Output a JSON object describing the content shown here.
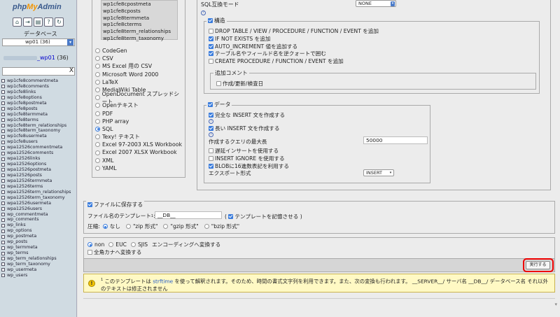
{
  "sidebar": {
    "logo": {
      "php": "php",
      "my": "My",
      "admin": "Admin"
    },
    "icons": [
      "home-icon",
      "exit-icon",
      "query-icon",
      "docs-icon",
      "reload-icon"
    ],
    "database_label": "データベース",
    "db_select_value": "wp01 (36)",
    "current_db": {
      "name": "_wp01",
      "count": "(36)"
    },
    "filter_clear": "X",
    "tables": [
      "wp1cfe8commentmeta",
      "wp1cfe8comments",
      "wp1cfe8links",
      "wp1cfe8options",
      "wp1cfe8postmeta",
      "wp1cfe8posts",
      "wp1cfe8termmeta",
      "wp1cfe8terms",
      "wp1cfe8term_relationships",
      "wp1cfe8term_taxonomy",
      "wp1cfe8usermeta",
      "wp1cfe8users",
      "wpa12526commentmeta",
      "wpa12526comments",
      "wpa12526links",
      "wpa12526options",
      "wpa12526postmeta",
      "wpa12526posts",
      "wpa12526termmeta",
      "wpa12526terms",
      "wpa12526term_relationships",
      "wpa12526term_taxonomy",
      "wpa12526usermeta",
      "wpa12526users",
      "wp_commentmeta",
      "wp_comments",
      "wp_links",
      "wp_options",
      "wp_postmeta",
      "wp_posts",
      "wp_termmeta",
      "wp_terms",
      "wp_term_relationships",
      "wp_term_taxonomy",
      "wp_usermeta",
      "wp_users"
    ]
  },
  "formats": {
    "selected_tables": [
      "wp1cfe8cpostmeta",
      "wp1cfe8cposts",
      "wp1cfe8termmeta",
      "wp1cfe8cterms",
      "wp1cfe8term_relationships",
      "wp1cfe8term_taxonomy"
    ],
    "list": [
      "CodeGen",
      "CSV",
      "MS Excel 用の CSV",
      "Microsoft Word 2000",
      "LaTeX",
      "MediaWiki Table",
      "OpenDocument スプレッドシート",
      "Openテキスト",
      "PDF",
      "PHP array",
      "SQL",
      "Texy! テキスト",
      "Excel 97-2003 XLS Workbook",
      "Excel 2007 XLSX Workbook",
      "XML",
      "YAML"
    ],
    "selected_index": 10
  },
  "options": {
    "sql_mode_label": "SQL互換モード",
    "sql_mode_value": "NONE",
    "structure": {
      "legend": "構造",
      "items": [
        {
          "label": "DROP TABLE / VIEW / PROCEDURE / FUNCTION / EVENT を追加",
          "checked": false
        },
        {
          "label": "IF NOT EXISTS を追加",
          "checked": true
        },
        {
          "label": "AUTO_INCREMENT 値を追加する",
          "checked": true
        },
        {
          "label": "テーブル名やフィールド名を逆クォートで囲む",
          "checked": true
        },
        {
          "label": "CREATE PROCEDURE / FUNCTION / EVENT を追加",
          "checked": false
        }
      ],
      "comment_legend": "追加コメント",
      "comment_item": "作成/更新/検査日"
    },
    "data": {
      "legend": "データ",
      "complete_insert": "完全な INSERT 文を作成する",
      "extended_insert": "長い INSERT 文を作成する",
      "max_query_label": "作成するクエリの最大長",
      "max_query_value": "50000",
      "delayed": "遅延インサートを使用する",
      "ignore": "INSERT IGNORE を使用する",
      "hex": "BLOBに16進数表記を利用する",
      "export_type_label": "エクスポート形式",
      "export_type_value": "INSERT"
    }
  },
  "save": {
    "legend": "ファイルに保存する",
    "template_label": "ファイル名のテンプレート",
    "template_sup": "1",
    "template_value": "__DB__",
    "remember_label": "テンプレートを記憶させる",
    "compression_label": "圧縮:",
    "compression_options": [
      "なし",
      "\"zip 形式\"",
      "\"gzip 形式\"",
      "\"bzip 形式\""
    ],
    "compression_selected": 0
  },
  "charset": {
    "options": [
      "non",
      "EUC",
      "SJIS"
    ],
    "selected": 0,
    "suffix": "エンコーディングへ変換する",
    "kana": "全角カナへ変換する"
  },
  "go_button": "実行する",
  "notice": {
    "sup": "1",
    "before": " このテンプレートは ",
    "link": "strftime",
    "after": " を使って解釈されます。そのため、時間の書式文字列を利用できます。また、次の変換も行われます。 __SERVER__/ サーバ名 __DB__/ データベース名 それ以外のテキストは修正されません"
  }
}
